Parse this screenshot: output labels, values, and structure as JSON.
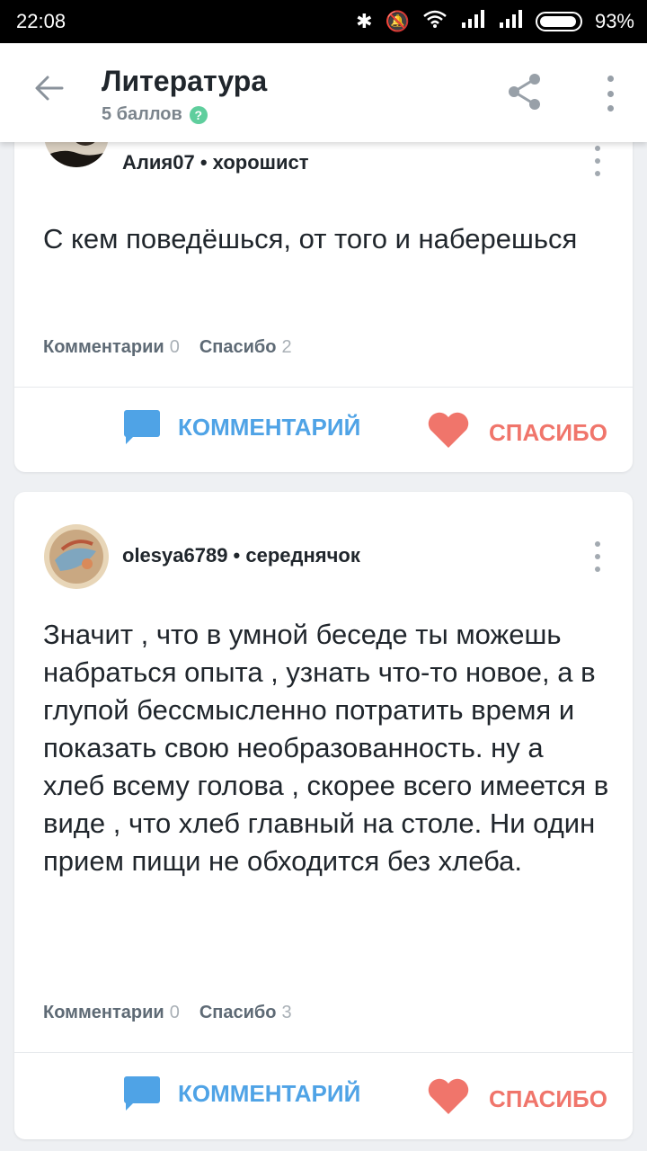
{
  "status": {
    "time": "22:08",
    "battery": "93%",
    "icons": [
      "bluetooth-icon",
      "mute-icon",
      "wifi-icon",
      "signal-icon",
      "signal-icon",
      "battery-icon"
    ]
  },
  "header": {
    "title": "Литература",
    "points": "5 баллов",
    "help": "?"
  },
  "answers": [
    {
      "author": "Алия07",
      "rank": "хорошист",
      "text": "С кем поведёшься, от того и наберешься",
      "comments_label": "Комментарии",
      "comments_count": "0",
      "thanks_label": "Спасибо",
      "thanks_count": "2",
      "comment_button": "КОММЕНТАРИЙ",
      "thanks_button": "СПАСИБО"
    },
    {
      "author": "olesya6789",
      "rank": "середнячок",
      "text": "Значит , что в умной беседе ты можешь набраться опыта , узнать что-то новое, а в глупой бессмысленно потратить время и показать свою необразованность. ну а хлеб всему голова , скорее всего имеется в виде , что хлеб главный на столе. Ни один прием пищи не обходится без хлеба.",
      "comments_label": "Комментарии",
      "comments_count": "0",
      "thanks_label": "Спасибо",
      "thanks_count": "3",
      "comment_button": "КОММЕНТАРИЙ",
      "thanks_button": "СПАСИБО"
    }
  ],
  "colors": {
    "accent_blue": "#4fa3e6",
    "accent_red": "#f0756b",
    "help_green": "#5fce9d"
  }
}
